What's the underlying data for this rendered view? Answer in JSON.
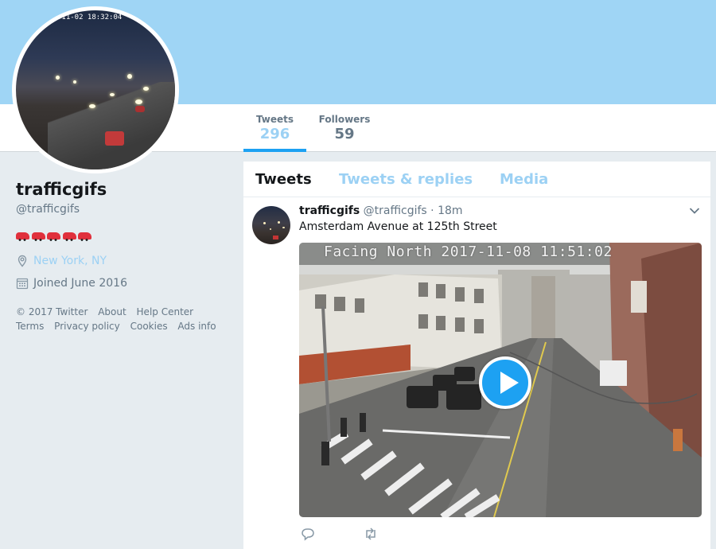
{
  "profile": {
    "name": "trafficgifs",
    "handle": "@trafficgifs",
    "bio_emoji": "🚗🚗🚗🚗🚗",
    "location": "New York, NY",
    "joined": "Joined June 2016",
    "avatar_timestamp": "-11-02 18:32:04"
  },
  "stats": {
    "tweets_label": "Tweets",
    "tweets_value": "296",
    "followers_label": "Followers",
    "followers_value": "59"
  },
  "footer": [
    "© 2017 Twitter",
    "About",
    "Help Center",
    "Terms",
    "Privacy policy",
    "Cookies",
    "Ads info"
  ],
  "tabs": {
    "tweets": "Tweets",
    "replies": "Tweets & replies",
    "media": "Media"
  },
  "tweet": {
    "name": "trafficgifs",
    "handle_time": "@trafficgifs · 18m",
    "text": "Amsterdam Avenue at 125th Street",
    "camera_timestamp": "Facing North 2017-11-08 11:51:02"
  },
  "icons": {
    "location": "map-pin-icon",
    "calendar": "calendar-icon",
    "chevron": "chevron-down-icon",
    "play": "play-icon",
    "reply": "reply-icon",
    "retweet": "retweet-icon"
  },
  "colors": {
    "accent": "#1da1f2",
    "banner": "#9fd5f5",
    "muted_link": "#9cd1f4",
    "secondary_text": "#657786"
  }
}
